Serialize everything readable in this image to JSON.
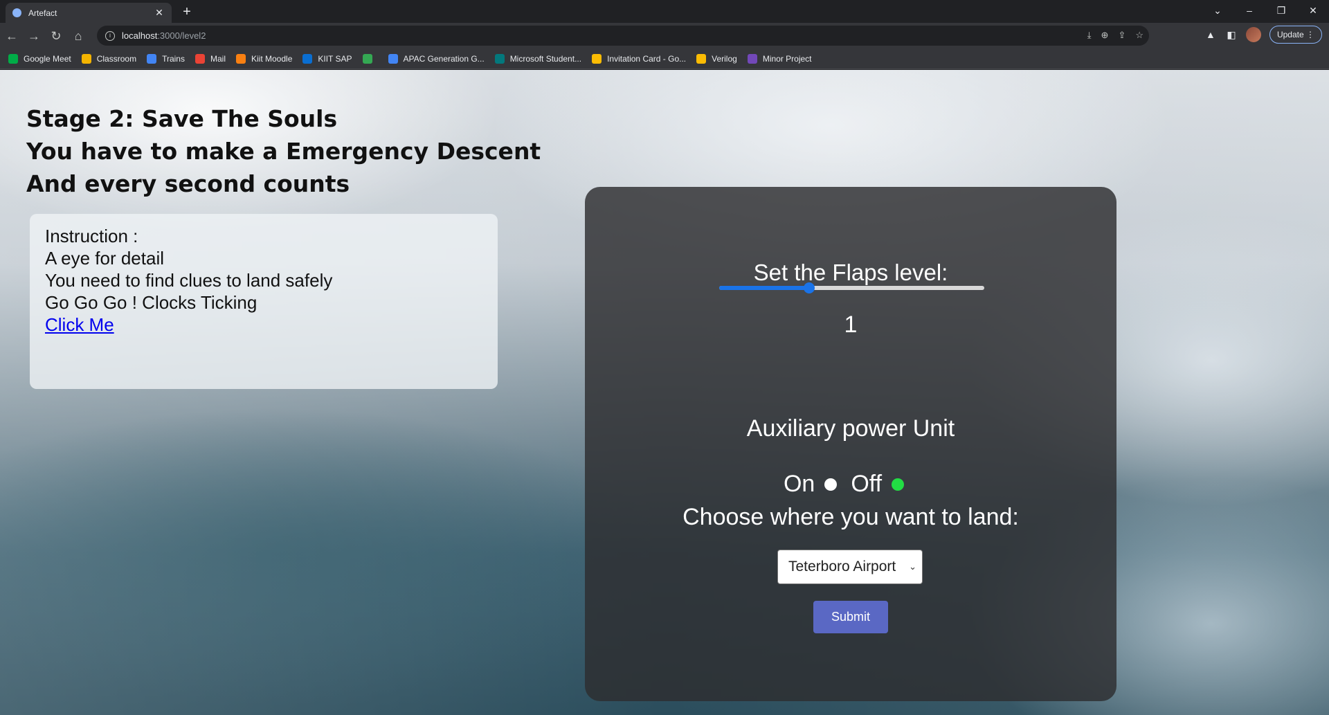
{
  "browser": {
    "tab": {
      "title": "Artefact",
      "close": "✕"
    },
    "new_tab": "+",
    "window_controls": {
      "dropdown": "⌄",
      "minimize": "–",
      "restore": "❐",
      "close": "✕"
    },
    "nav": {
      "back": "←",
      "forward": "→",
      "reload": "↻",
      "home": "⌂"
    },
    "url": {
      "host": "localhost",
      "path": ":3000/level2"
    },
    "update_label": "Update",
    "bookmarks": [
      {
        "label": "Google Meet",
        "icon": "google-meet-icon",
        "color": "#00ac47"
      },
      {
        "label": "Classroom",
        "icon": "classroom-icon",
        "color": "#f4b400"
      },
      {
        "label": "Trains",
        "icon": "trains-icon",
        "color": "#4285f4"
      },
      {
        "label": "Mail",
        "icon": "gmail-icon",
        "color": "#ea4335"
      },
      {
        "label": "Kiit Moodle",
        "icon": "moodle-icon",
        "color": "#f98012"
      },
      {
        "label": "KIIT SAP",
        "icon": "sap-icon",
        "color": "#0a6ed1"
      },
      {
        "label": "",
        "icon": "google-drive-icon",
        "color": "#34a853"
      },
      {
        "label": "APAC Generation G...",
        "icon": "docs-icon",
        "color": "#4285f4"
      },
      {
        "label": "Microsoft Student...",
        "icon": "forms-icon",
        "color": "#03787c"
      },
      {
        "label": "Invitation Card - Go...",
        "icon": "google-drive-icon",
        "color": "#fbbc04"
      },
      {
        "label": "Verilog",
        "icon": "keep-icon",
        "color": "#fbbc04"
      },
      {
        "label": "Minor Project",
        "icon": "forms-icon",
        "color": "#7248b9"
      }
    ]
  },
  "page": {
    "heading": [
      "Stage 2: Save The Souls",
      "You have to make a Emergency Descent",
      "And every second counts"
    ],
    "instructions": {
      "lines": [
        "Instruction :",
        "A eye for detail",
        "You need to find clues to land safely",
        "Go Go Go ! Clocks Ticking"
      ],
      "link": "Click Me"
    },
    "panel": {
      "flaps_label": "Set the Flaps level:",
      "flaps_value": "1",
      "flaps_fraction": 0.34,
      "apu_label": "Auxiliary power Unit",
      "apu_on": "On",
      "apu_off": "Off",
      "apu_selected": "Off",
      "land_label": "Choose where you want to land:",
      "land_selected": "Teterboro Airport",
      "submit_label": "Submit"
    }
  }
}
